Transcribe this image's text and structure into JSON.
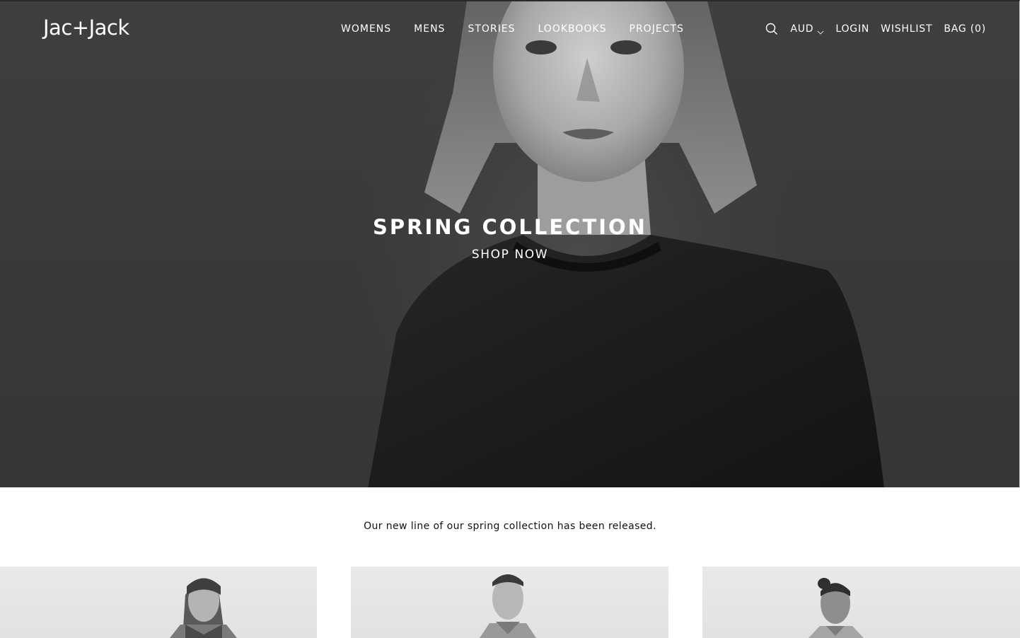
{
  "brand": {
    "logo_text": "Jac+Jack"
  },
  "nav": {
    "items": [
      {
        "label": "WOMENS"
      },
      {
        "label": "MENS"
      },
      {
        "label": "STORIES"
      },
      {
        "label": "LOOKBOOKS"
      },
      {
        "label": "PROJECTS"
      }
    ]
  },
  "utilities": {
    "search_icon": "search-icon",
    "currency": "AUD",
    "currency_icon": "chevron-down-icon",
    "login": "LOGIN",
    "wishlist": "WISHLIST",
    "bag": "BAG (0)"
  },
  "hero": {
    "title": "SPRING COLLECTION",
    "cta": "SHOP NOW"
  },
  "intro": {
    "text": "Our new line of our spring collection has been released."
  },
  "colors": {
    "hero_background": "#3a3a3a",
    "header_text": "#ffffff",
    "page_background": "#ffffff",
    "tile_background": "#e6e6e6"
  }
}
